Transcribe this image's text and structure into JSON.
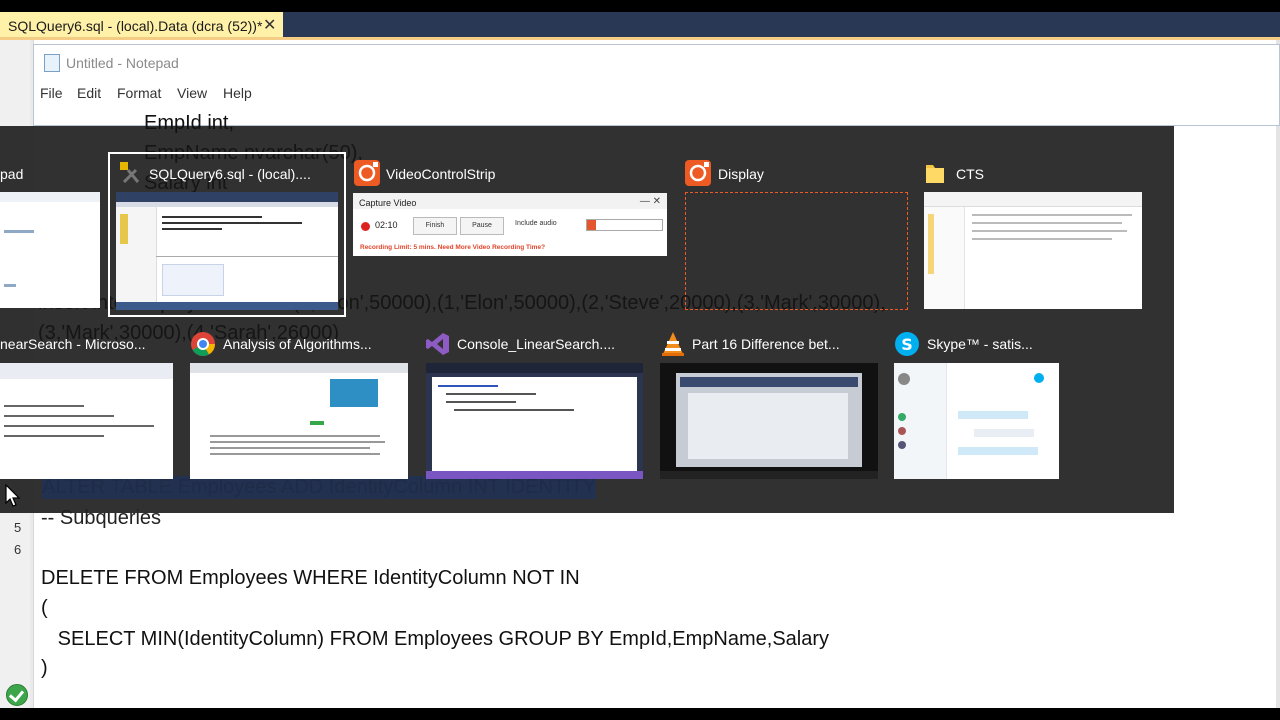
{
  "ssms": {
    "tab_title": "SQLQuery6.sql - (local).Data (dcra (52))*",
    "close_glyph": "✕",
    "code_behind": [
      "EmpId int,",
      "EmpName nvarchar(50),",
      "Salary int",
      "insert into Employees values(1,'Elon',50000),(1,'Elon',50000),(2,'Steve',20000),(3,'Mark',30000),",
      "(3,'Mark',30000),(4,'Sarah',26000)",
      "ALTER TABLE Employees ADD IdentityColumn INT IDENTITY"
    ],
    "line_numbers": [
      "5",
      "6"
    ],
    "code_lines": [
      "-- Subqueries",
      "DELETE FROM Employees WHERE IdentityColumn NOT IN",
      "(",
      "   SELECT MIN(IdentityColumn) FROM Employees GROUP BY EmpId,EmpName,Salary",
      ")"
    ]
  },
  "notepad": {
    "title": "Untitled - Notepad",
    "menu": [
      "File",
      "Edit",
      "Format",
      "View",
      "Help"
    ]
  },
  "switcher": {
    "row1": [
      {
        "label": "pad",
        "icon": "notepad-icon"
      },
      {
        "label": "SQLQuery6.sql - (local)....",
        "icon": "ssms-icon",
        "selected": true
      },
      {
        "label": "VideoControlStrip",
        "icon": "record-icon"
      },
      {
        "label": "Display",
        "icon": "record-icon"
      },
      {
        "label": "CTS",
        "icon": "folder-icon"
      }
    ],
    "row2": [
      {
        "label": "nearSearch - Microso...",
        "icon": "word-icon"
      },
      {
        "label": "Analysis of Algorithms...",
        "icon": "chrome-icon"
      },
      {
        "label": "Console_LinearSearch....",
        "icon": "visual-studio-icon"
      },
      {
        "label": "Part 16 Difference bet...",
        "icon": "vlc-icon"
      },
      {
        "label": "Skype™ - satis...",
        "icon": "skype-icon"
      }
    ],
    "capture_video": {
      "title": "Capture Video",
      "window_buttons": "—  ✕",
      "time": "02:10",
      "finish": "Finish",
      "pause": "Pause",
      "include_audio": "Include audio",
      "level": 0.12,
      "limit_text": "Recording Limit: 5 mins. Need More Video Recording Time?"
    }
  },
  "colors": {
    "tab_active": "#fff1a8",
    "tab_accent": "#f5cc84",
    "ssms_chrome": "#293955",
    "switcher_bg": "#212121",
    "record_orange": "#ee5a24",
    "status_green": "#3da54a"
  }
}
